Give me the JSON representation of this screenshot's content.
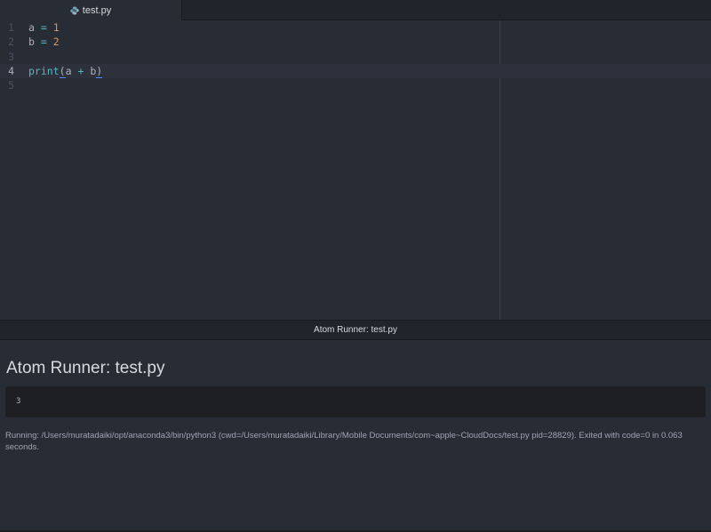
{
  "tab": {
    "label": "test.py",
    "icon": "python-file-icon"
  },
  "editor": {
    "lines": [
      {
        "number": "1",
        "text": "a = 1"
      },
      {
        "number": "2",
        "text": "b = 2"
      },
      {
        "number": "3",
        "text": ""
      },
      {
        "number": "4",
        "text": "print(a + b)"
      },
      {
        "number": "5",
        "text": ""
      }
    ],
    "tokens": {
      "a": "a",
      "b": "b",
      "eq": "=",
      "one": "1",
      "two": "2",
      "print": "print",
      "lparen": "(",
      "rparen": ")",
      "plus": "+"
    }
  },
  "runner": {
    "header": "Atom Runner: test.py",
    "title": "Atom Runner: test.py",
    "output": "3",
    "status": "Running: /Users/muratadaiki/opt/anaconda3/bin/python3 (cwd=/Users/muratadaiki/Library/Mobile Documents/com~apple~CloudDocs/test.py pid=28829). Exited with code=0 in 0.063 seconds."
  },
  "colors": {
    "background": "#282c34",
    "panel": "#21252b",
    "operator": "#56b6c2",
    "number": "#d19a66",
    "text": "#abb2bf"
  }
}
